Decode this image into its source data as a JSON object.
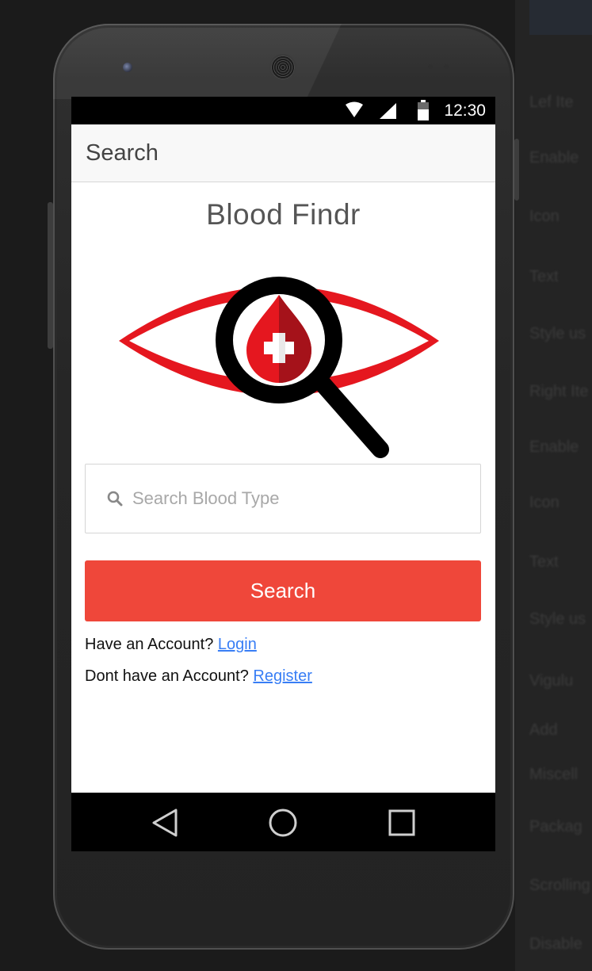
{
  "status_bar": {
    "time": "12:30",
    "icons": [
      "wifi-icon",
      "cell-signal-icon",
      "battery-icon"
    ]
  },
  "app_bar": {
    "title": "Search"
  },
  "brand": {
    "title": "Blood Findr",
    "logo_icon": "eye-magnifier-blood-drop-logo"
  },
  "search": {
    "placeholder": "Search Blood Type",
    "value": "",
    "icon": "search-icon",
    "button_label": "Search"
  },
  "account": {
    "have_account_text": "Have an Account?",
    "login_link": "Login",
    "no_account_text": "Dont have an Account?",
    "register_link": "Register"
  },
  "nav_bar": {
    "buttons": [
      "back-icon",
      "home-icon",
      "recents-icon"
    ]
  },
  "colors": {
    "accent": "#ef473a",
    "link": "#387ef5",
    "logo_red": "#e5171f"
  }
}
